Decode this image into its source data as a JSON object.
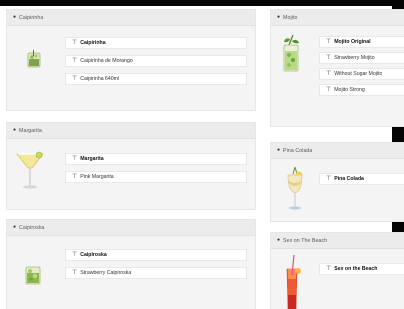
{
  "colors": {
    "background": "#ffffff",
    "card": "#f4f4f4",
    "header": "#ececec",
    "border": "#e6e6e6",
    "frame": "#050505"
  },
  "icons": {
    "header": "bullet-icon",
    "row": "pin-icon"
  },
  "cards": {
    "caipirinha": {
      "title": "Caipirinha",
      "image": "caipirinha-glass-icon",
      "rows": [
        "Caipirinha",
        "Caipirinha de Morango",
        "Caipirinha 640ml"
      ]
    },
    "mojito": {
      "title": "Mojito",
      "image": "mojito-glass-icon",
      "rows": [
        "Mojito Original",
        "Strawberry Mojito",
        "Without Sugar Mojito",
        "Mojito Strong"
      ]
    },
    "margarita": {
      "title": "Margarita",
      "image": "margarita-glass-icon",
      "rows": [
        "Margarita",
        "Pink Margarita"
      ]
    },
    "pina_colada": {
      "title": "Pina Colada",
      "image": "pina-colada-glass-icon",
      "rows": [
        "Pina Colada"
      ]
    },
    "caipiroska": {
      "title": "Caipiroska",
      "image": "caipiroska-glass-icon",
      "rows": [
        "Caipiroska",
        "Strawberry Caipiroska"
      ]
    },
    "sex_on_the_beach": {
      "title": "Sex on The Beach",
      "image": "sex-on-the-beach-glass-icon",
      "rows": [
        "Sex on the Beach"
      ]
    }
  }
}
